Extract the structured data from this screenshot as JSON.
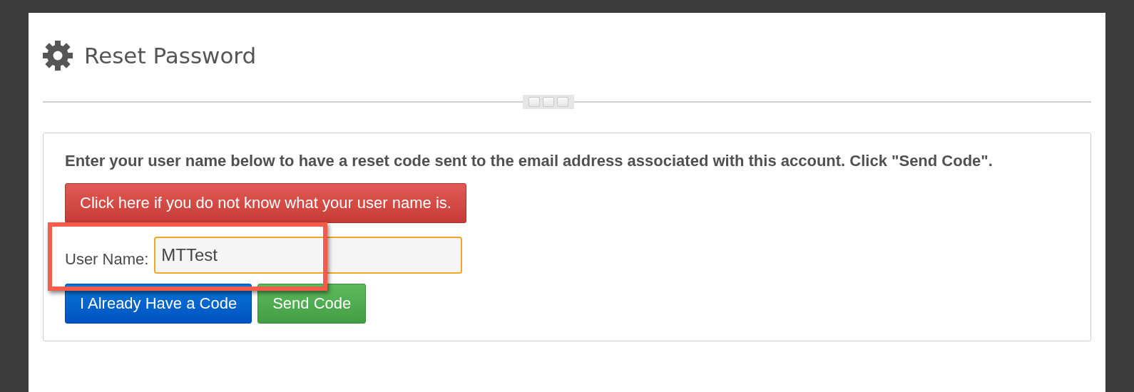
{
  "page": {
    "title": "Reset Password"
  },
  "form": {
    "instructions": "Enter your user name below to have a reset code sent to the email address associated with this account. Click \"Send Code\".",
    "help_button": "Click here if you do not know what your user name is.",
    "user_name": {
      "label": "User Name:",
      "value": "MTTest"
    },
    "buttons": [
      {
        "label": "I Already Have a Code",
        "kind": "primary"
      },
      {
        "label": "Send Code",
        "kind": "success"
      }
    ]
  }
}
